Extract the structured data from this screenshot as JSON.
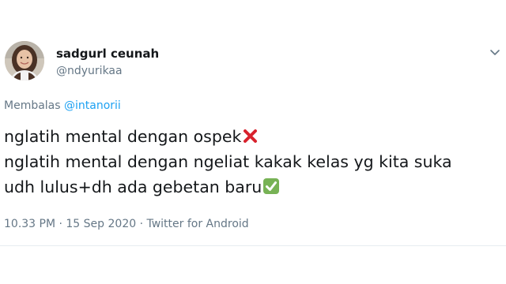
{
  "user": {
    "display_name": "sadgurl ceunah",
    "handle": "@ndyurikaa"
  },
  "reply": {
    "prefix": "Membalas ",
    "mention": "@intanorii"
  },
  "tweet": {
    "line1": "nglatih mental dengan ospek",
    "line2": "nglatih mental dengan ngeliat kakak kelas yg kita suka",
    "line3": "udh lulus+dh ada gebetan baru"
  },
  "meta": {
    "text": "10.33 PM · 15 Sep 2020 · Twitter for Android"
  },
  "icons": {
    "cross": "cross-mark-icon",
    "check": "check-mark-icon",
    "menu": "chevron-down-icon"
  },
  "colors": {
    "text": "#14171a",
    "secondary": "#657786",
    "link": "#1da1f2",
    "cross": "#d8222d",
    "check": "#77b255"
  }
}
